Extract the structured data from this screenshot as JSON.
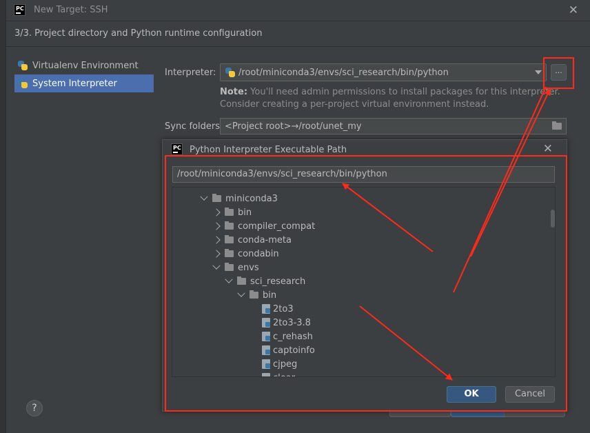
{
  "window": {
    "title": "New Target: SSH",
    "step_header": "3/3. Project directory and Python runtime configuration",
    "logo_text": "PC"
  },
  "env_types": [
    {
      "label": "Virtualenv Environment",
      "selected": false
    },
    {
      "label": "System Interpreter",
      "selected": true
    }
  ],
  "form": {
    "interpreter_label": "Interpreter:",
    "interpreter_value": "/root/miniconda3/envs/sci_research/bin/python",
    "browse_label": "...",
    "note_bold": "Note:",
    "note_text": " You'll need admin permissions to install packages for this interpreter. Consider creating a per-project virtual environment instead.",
    "sync_label": "Sync folders:",
    "sync_value": "<Project root>→/root/unet_my"
  },
  "help_label": "?",
  "sub_dialog": {
    "title": "Python Interpreter Executable Path",
    "logo_text": "PC",
    "path_value": "/root/miniconda3/envs/sci_research/bin/python",
    "tree": [
      {
        "label": "miniconda3",
        "depth": 0,
        "kind": "folder",
        "expanded": true
      },
      {
        "label": "bin",
        "depth": 1,
        "kind": "folder",
        "expanded": false
      },
      {
        "label": "compiler_compat",
        "depth": 1,
        "kind": "folder",
        "expanded": false
      },
      {
        "label": "conda-meta",
        "depth": 1,
        "kind": "folder",
        "expanded": false
      },
      {
        "label": "condabin",
        "depth": 1,
        "kind": "folder",
        "expanded": false
      },
      {
        "label": "envs",
        "depth": 1,
        "kind": "folder",
        "expanded": true
      },
      {
        "label": "sci_research",
        "depth": 2,
        "kind": "folder",
        "expanded": true
      },
      {
        "label": "bin",
        "depth": 3,
        "kind": "folder",
        "expanded": true
      },
      {
        "label": "2to3",
        "depth": 4,
        "kind": "file"
      },
      {
        "label": "2to3-3.8",
        "depth": 4,
        "kind": "file"
      },
      {
        "label": "c_rehash",
        "depth": 4,
        "kind": "file"
      },
      {
        "label": "captoinfo",
        "depth": 4,
        "kind": "file"
      },
      {
        "label": "cjpeg",
        "depth": 4,
        "kind": "file"
      },
      {
        "label": "clear",
        "depth": 4,
        "kind": "file"
      }
    ],
    "ok_label": "OK",
    "cancel_label": "Cancel"
  },
  "colors": {
    "annotation": "#ff2a1a",
    "selection": "#4b6eaf",
    "primary_button": "#365880"
  }
}
